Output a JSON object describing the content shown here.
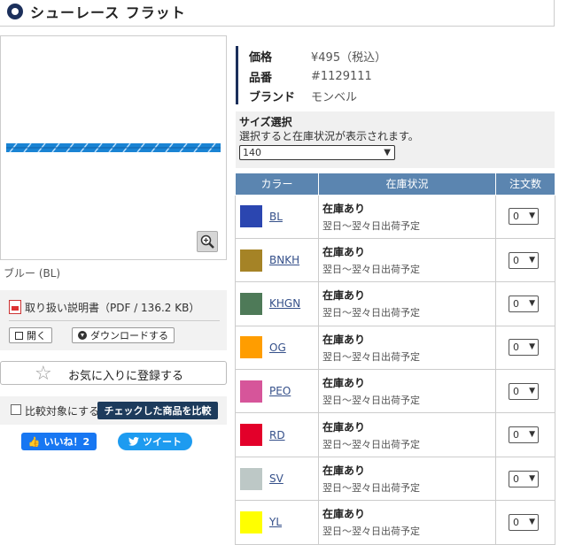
{
  "header": {
    "title": "シューレース フラット"
  },
  "product": {
    "image_caption": "ブルー (BL)",
    "price_label": "価格",
    "price_value": "¥495（税込）",
    "sku_label": "品番",
    "sku_value": "#1129111",
    "brand_label": "ブランド",
    "brand_value": "モンベル"
  },
  "manual": {
    "label": "取り扱い説明書（PDF / 136.2 KB）",
    "open_label": "開く",
    "download_label": "ダウンロードする"
  },
  "favorite": {
    "label": "お気に入りに登録する"
  },
  "compare": {
    "checkbox_label": "比較対象にする",
    "button_label": "チェックした商品を比較"
  },
  "social": {
    "like_label": "いいね！2",
    "tweet_label": "ツイート"
  },
  "size": {
    "title": "サイズ選択",
    "description": "選択すると在庫状況が表示されます。",
    "selected": "140"
  },
  "table": {
    "headers": {
      "color": "カラー",
      "stock": "在庫状況",
      "qty": "注文数"
    },
    "rows": [
      {
        "code": "BL",
        "swatch": "#2b46b0",
        "status": "在庫あり",
        "ship": "翌日〜翌々日出荷予定",
        "qty": "0"
      },
      {
        "code": "BNKH",
        "swatch": "#a58326",
        "status": "在庫あり",
        "ship": "翌日〜翌々日出荷予定",
        "qty": "0"
      },
      {
        "code": "KHGN",
        "swatch": "#4e7a58",
        "status": "在庫あり",
        "ship": "翌日〜翌々日出荷予定",
        "qty": "0"
      },
      {
        "code": "OG",
        "swatch": "#ff9d00",
        "status": "在庫あり",
        "ship": "翌日〜翌々日出荷予定",
        "qty": "0"
      },
      {
        "code": "PEO",
        "swatch": "#d6559a",
        "status": "在庫あり",
        "ship": "翌日〜翌々日出荷予定",
        "qty": "0"
      },
      {
        "code": "RD",
        "swatch": "#e3002a",
        "status": "在庫あり",
        "ship": "翌日〜翌々日出荷予定",
        "qty": "0"
      },
      {
        "code": "SV",
        "swatch": "#bdc8c6",
        "status": "在庫あり",
        "ship": "翌日〜翌々日出荷予定",
        "qty": "0"
      },
      {
        "code": "YL",
        "swatch": "#ffff00",
        "status": "在庫あり",
        "ship": "翌日〜翌々日出荷予定",
        "qty": "0"
      }
    ]
  }
}
